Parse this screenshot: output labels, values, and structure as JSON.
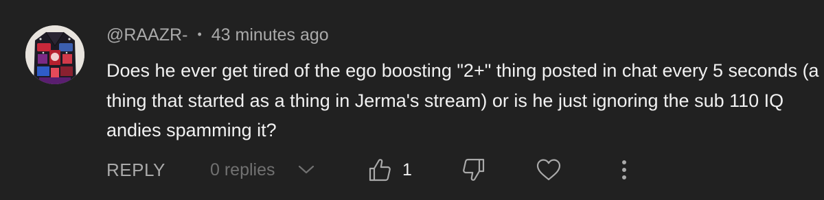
{
  "comment": {
    "author": "@RAAZR-",
    "separator": "•",
    "timestamp": "43 minutes ago",
    "text_lines": [
      "Does he ever get tired of the ego boosting \"2+\" thing posted in chat every 5 seconds (a",
      "thing that started as a thing in Jerma's stream) or is he just ignoring the sub 110 IQ",
      "andies spamming it?"
    ]
  },
  "actions": {
    "reply_label": "REPLY",
    "replies_label": "0 replies",
    "like_count": "1"
  },
  "icons": {
    "avatar": "avatar-image",
    "replies_toggle": "chevron-down-icon",
    "like": "thumbs-up-icon",
    "dislike": "thumbs-down-icon",
    "heart": "heart-icon",
    "more": "more-vertical-icon"
  },
  "colors": {
    "background": "#212121",
    "primary_text": "#f1f1f1",
    "secondary_text": "#aaaaaa",
    "muted_text": "#717171"
  }
}
